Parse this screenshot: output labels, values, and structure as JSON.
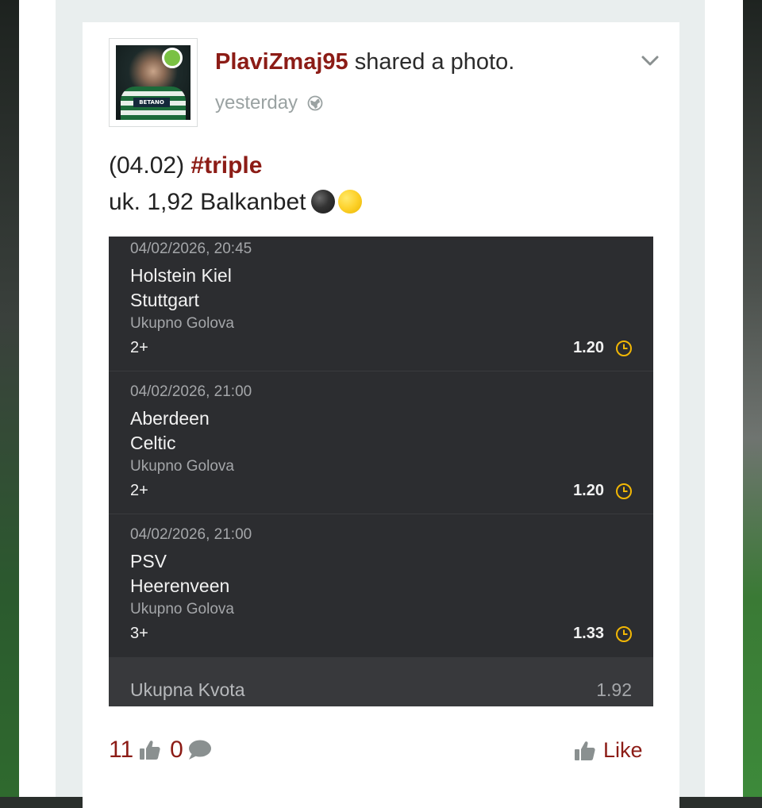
{
  "post": {
    "author": "PlaviZmaj95",
    "action": " shared a photo.",
    "time": "yesterday",
    "text_date": "(04.02) ",
    "hashtag": "#triple",
    "text_line2": "uk. 1,92 Balkanbet",
    "avatar_sponsor": "BETANO"
  },
  "ticket": {
    "matches": [
      {
        "date": "04/02/2026, 20:45",
        "home": "Holstein Kiel",
        "away": "Stuttgart",
        "market": "Ukupno Golova",
        "pick": "2+",
        "odd": "1.20"
      },
      {
        "date": "04/02/2026, 21:00",
        "home": "Aberdeen",
        "away": "Celtic",
        "market": "Ukupno Golova",
        "pick": "2+",
        "odd": "1.20"
      },
      {
        "date": "04/02/2026, 21:00",
        "home": "PSV",
        "away": "Heerenveen",
        "market": "Ukupno Golova",
        "pick": "3+",
        "odd": "1.33"
      }
    ],
    "total_label": "Ukupna Kvota",
    "total_value": "1.92"
  },
  "reactions": {
    "likes": "11",
    "comments": "0",
    "like_button": "Like"
  },
  "colors": {
    "brand": "#8c1c16",
    "online": "#7ac143",
    "clock": "#f2b705",
    "ticket_bg": "#2c2d30"
  },
  "icons": [
    "chevron-down-icon",
    "globe-icon",
    "clock-icon",
    "thumb-up-icon",
    "comment-icon",
    "online-status-icon"
  ]
}
